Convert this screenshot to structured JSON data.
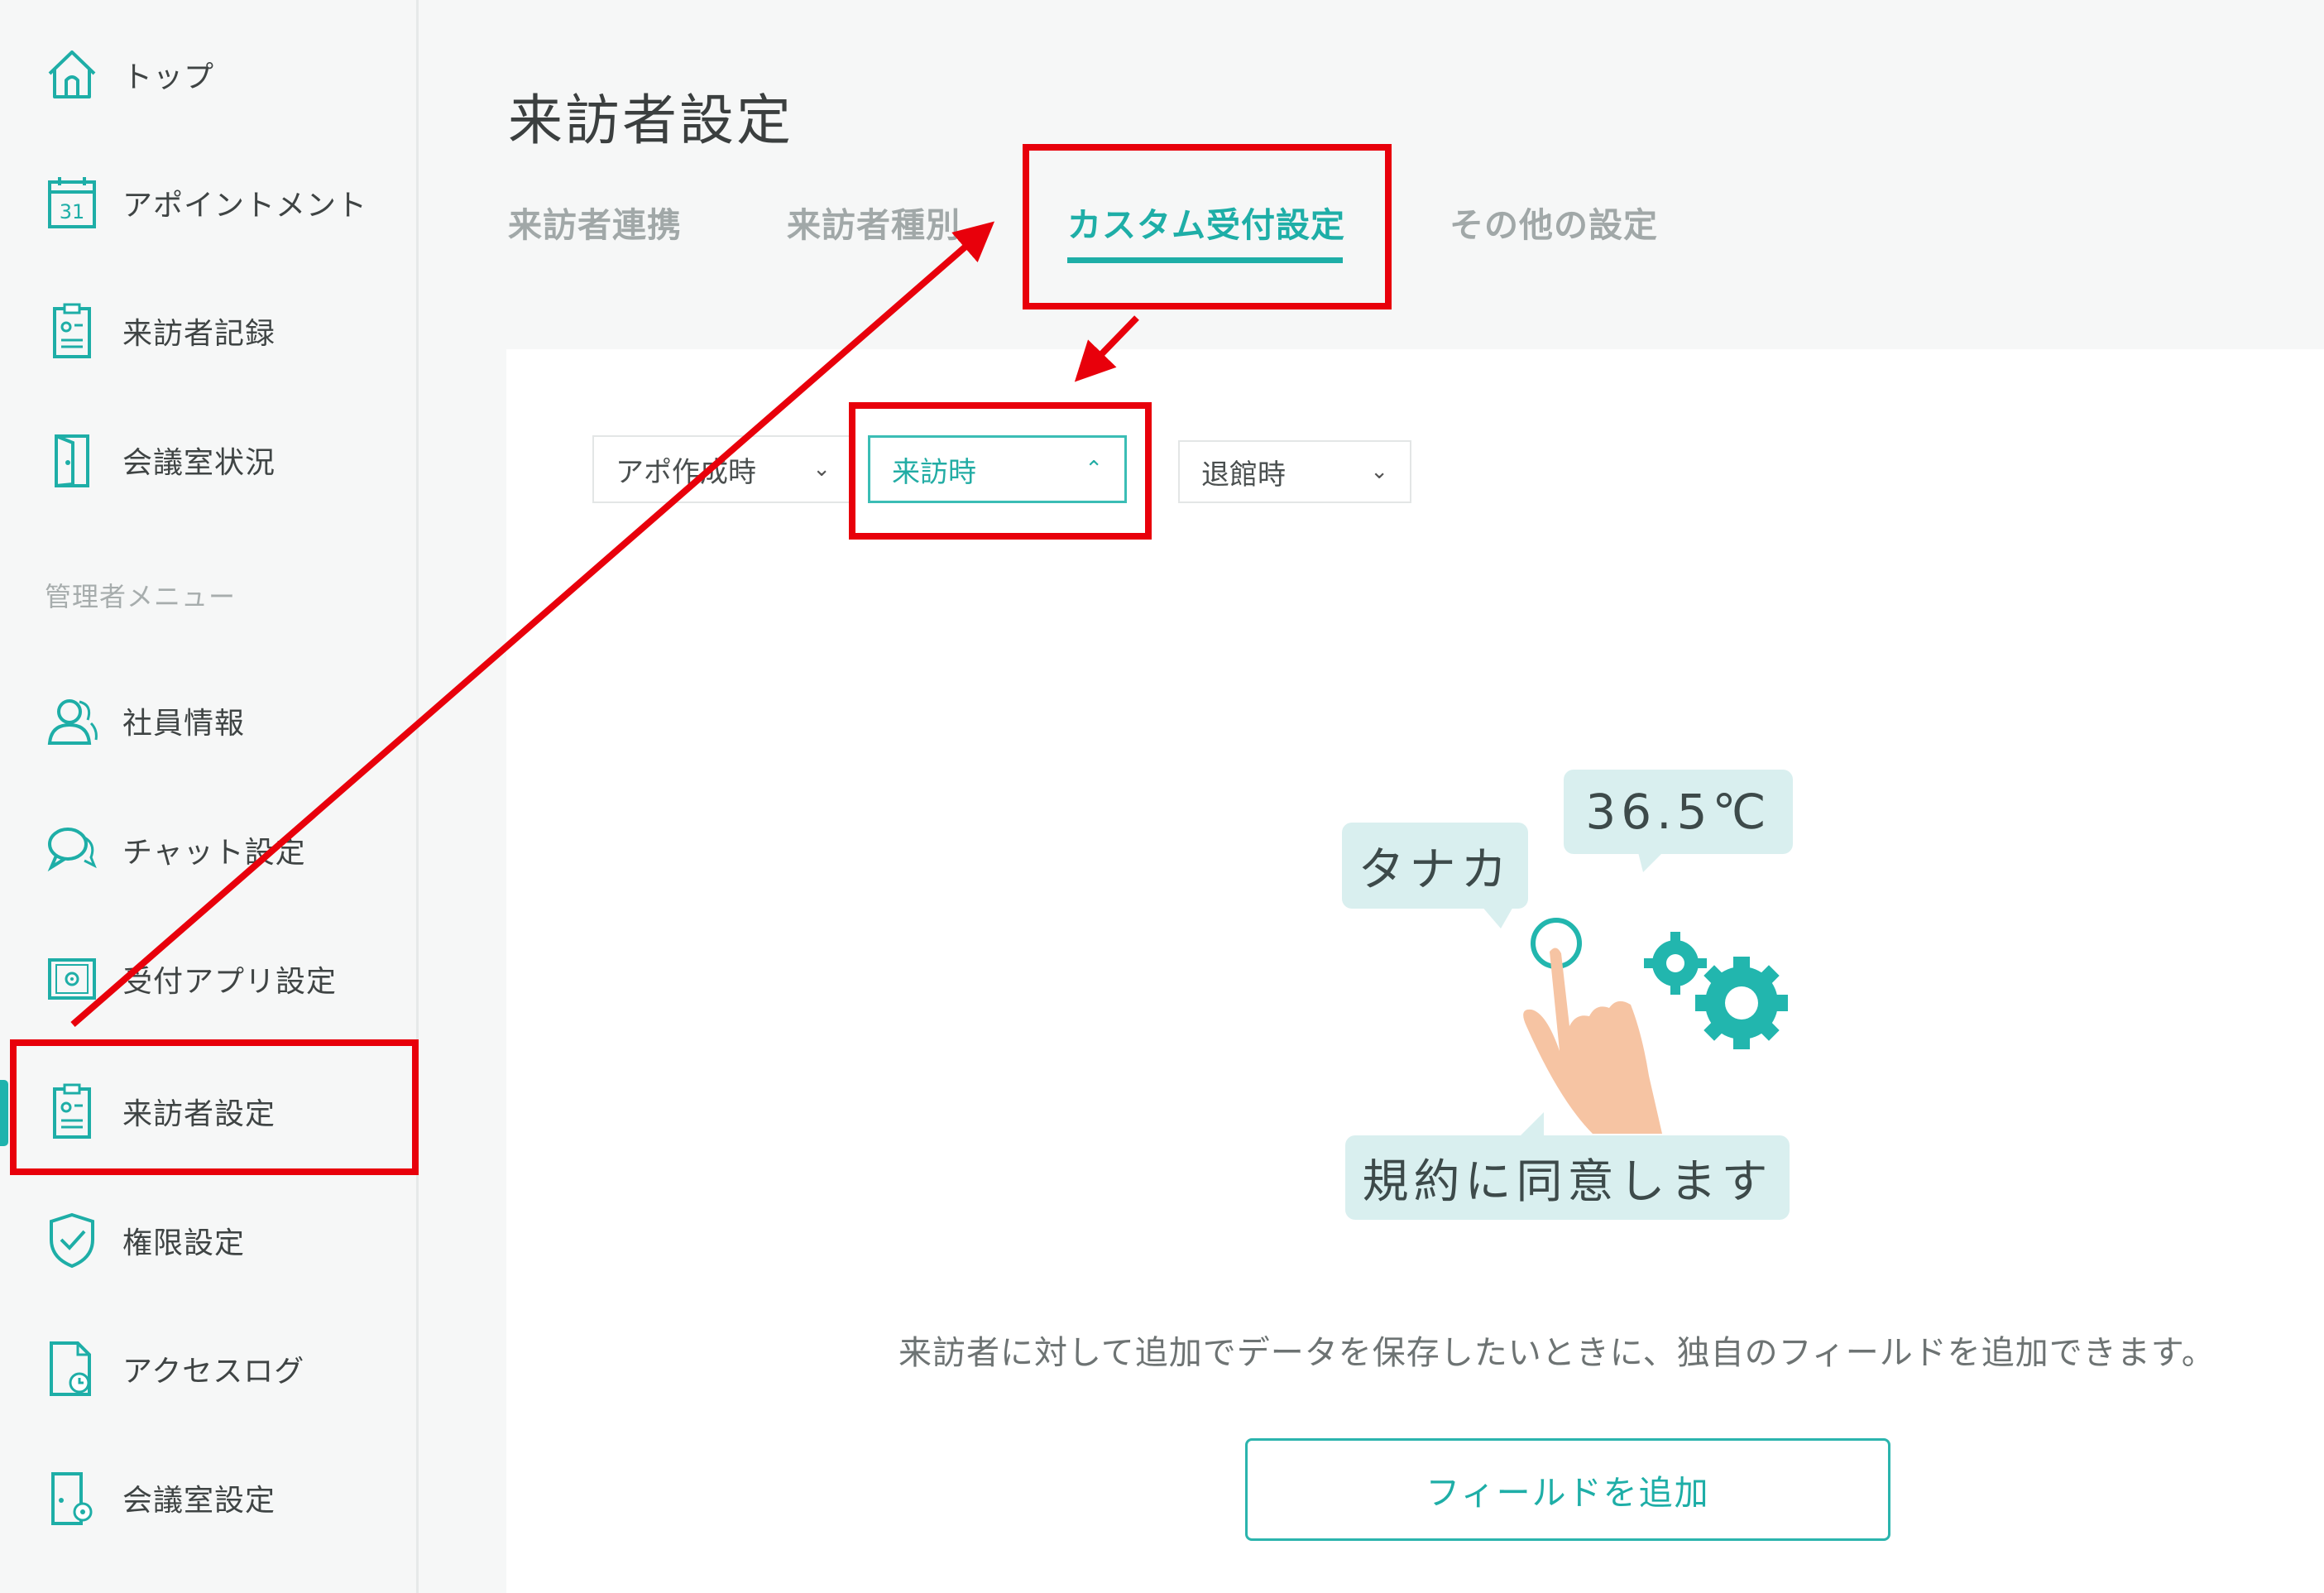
{
  "sidebar": {
    "items": [
      {
        "label": "トップ",
        "icon": "home-icon"
      },
      {
        "label": "アポイントメント",
        "icon": "calendar-icon",
        "icon_text": "31"
      },
      {
        "label": "来訪者記録",
        "icon": "clipboard-icon"
      },
      {
        "label": "会議室状況",
        "icon": "door-icon"
      }
    ],
    "section_label": "管理者メニュー",
    "admin_items": [
      {
        "label": "社員情報",
        "icon": "users-icon"
      },
      {
        "label": "チャット設定",
        "icon": "chat-icon"
      },
      {
        "label": "受付アプリ設定",
        "icon": "tablet-gear-icon"
      },
      {
        "label": "来訪者設定",
        "icon": "clipboard-icon",
        "active": true
      },
      {
        "label": "権限設定",
        "icon": "shield-check-icon"
      },
      {
        "label": "アクセスログ",
        "icon": "document-clock-icon"
      },
      {
        "label": "会議室設定",
        "icon": "door-gear-icon"
      }
    ]
  },
  "main": {
    "title": "来訪者設定",
    "tabs": [
      {
        "label": "来訪者連携"
      },
      {
        "label": "来訪者種別"
      },
      {
        "label": "カスタム受付設定",
        "active": true
      },
      {
        "label": "その他の設定"
      }
    ],
    "dropdowns": [
      {
        "value": "アポ作成時"
      },
      {
        "value": "来訪時",
        "active": true
      },
      {
        "value": "退館時"
      }
    ],
    "illustration": {
      "bubble_name": "タナカ",
      "bubble_temp": "36.5℃",
      "bubble_agree": "規約に同意します"
    },
    "description": "来訪者に対して追加でデータを保存したいときに、独自のフィールドを追加できます。",
    "add_button": "フィールドを追加"
  },
  "colors": {
    "accent": "#1eaea7",
    "annotation": "#e8000b",
    "sidebar_bg": "#f6f7f7",
    "bubble_bg": "#d9efef"
  }
}
